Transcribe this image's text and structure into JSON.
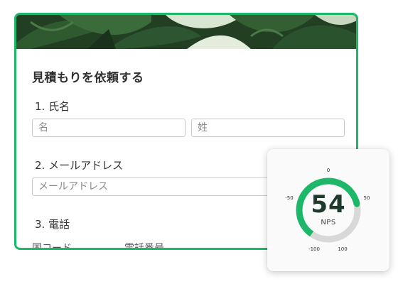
{
  "form": {
    "title": "見積もりを依頼する",
    "questions": [
      {
        "label": "1. 氏名",
        "fields": [
          {
            "placeholder": "名"
          },
          {
            "placeholder": "姓"
          }
        ]
      },
      {
        "label": "2. メールアドレス",
        "fields": [
          {
            "placeholder": "メールアドレス"
          }
        ]
      },
      {
        "label": "3. 電話",
        "sublabels": [
          "国コード",
          "電話番号"
        ]
      }
    ]
  },
  "nps": {
    "value": "54",
    "unit": "NPS",
    "level_fraction": 0.77,
    "ticks": [
      "0",
      "50",
      "100",
      "-100",
      "-50"
    ],
    "accent_color": "#1db76a",
    "track_color": "#d8d8d8"
  },
  "colors": {
    "accent": "#1db76a",
    "title_text": "#2f2f2f",
    "banner_dark": "#1d3a1f"
  }
}
